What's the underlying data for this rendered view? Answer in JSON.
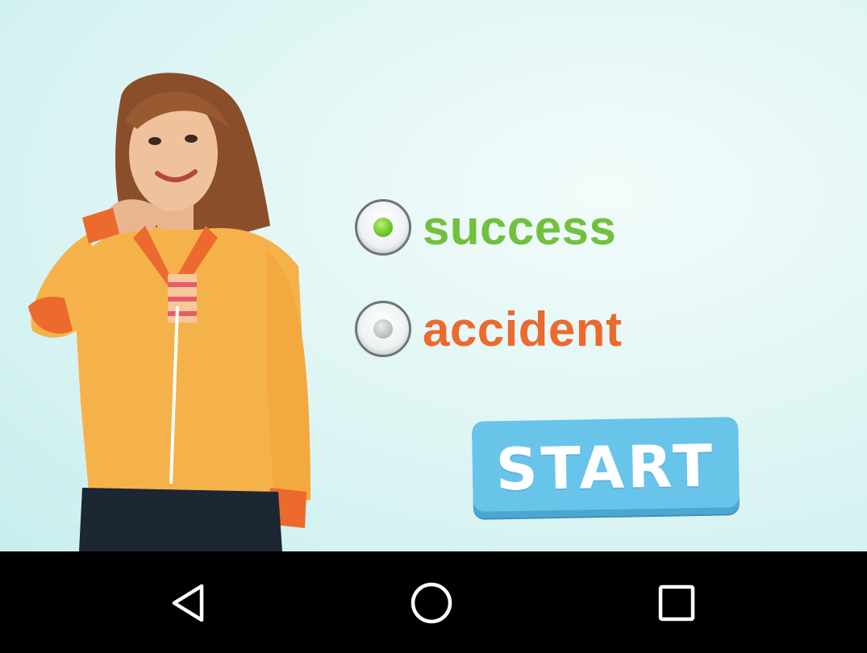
{
  "options": [
    {
      "label": "success",
      "selected": true,
      "color": "#72c03e"
    },
    {
      "label": "accident",
      "selected": false,
      "color": "#ec6a2e"
    }
  ],
  "start_button": {
    "label": "START",
    "color": "#69c4ea"
  },
  "nav": {
    "back": "back-icon",
    "home": "home-icon",
    "recents": "recents-icon"
  }
}
